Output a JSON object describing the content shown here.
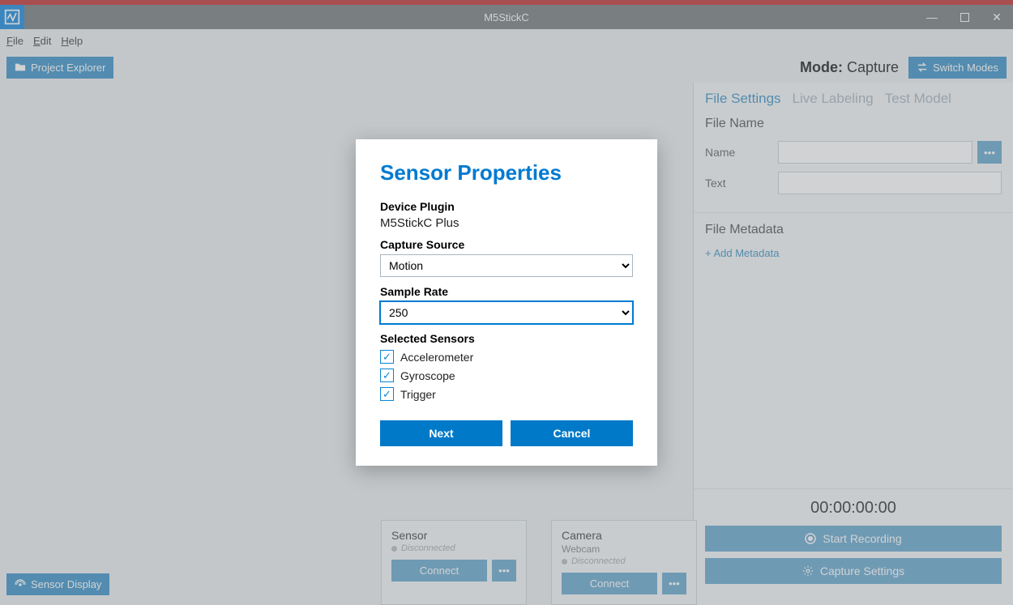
{
  "titlebar": {
    "title": "M5StickC"
  },
  "menu": {
    "file": "File",
    "edit": "Edit",
    "help": "Help"
  },
  "toolbar": {
    "project_explorer": "Project Explorer",
    "mode_label": "Mode:",
    "mode_value": "Capture",
    "switch_modes": "Switch Modes"
  },
  "sensor_display_btn": "Sensor Display",
  "status_cards": {
    "sensor": {
      "title": "Sensor",
      "status": "Disconnected",
      "connect": "Connect"
    },
    "camera": {
      "title": "Camera",
      "subtitle": "Webcam",
      "status": "Disconnected",
      "connect": "Connect"
    }
  },
  "right_panel": {
    "tabs": {
      "file_settings": "File Settings",
      "live_labeling": "Live Labeling",
      "test_model": "Test Model"
    },
    "file_name_section": "File Name",
    "name_label": "Name",
    "text_label": "Text",
    "name_value": "",
    "text_value": "",
    "metadata_section": "File Metadata",
    "add_metadata": "+ Add Metadata",
    "timer": "00:00:00:00",
    "start_recording": "Start Recording",
    "capture_settings": "Capture Settings"
  },
  "modal": {
    "title": "Sensor Properties",
    "device_plugin_label": "Device Plugin",
    "device_plugin_value": "M5StickC Plus",
    "capture_source_label": "Capture Source",
    "capture_source_value": "Motion",
    "sample_rate_label": "Sample Rate",
    "sample_rate_value": "250",
    "selected_sensors_label": "Selected Sensors",
    "sensors": {
      "accel": "Accelerometer",
      "gyro": "Gyroscope",
      "trigger": "Trigger"
    },
    "next": "Next",
    "cancel": "Cancel"
  }
}
